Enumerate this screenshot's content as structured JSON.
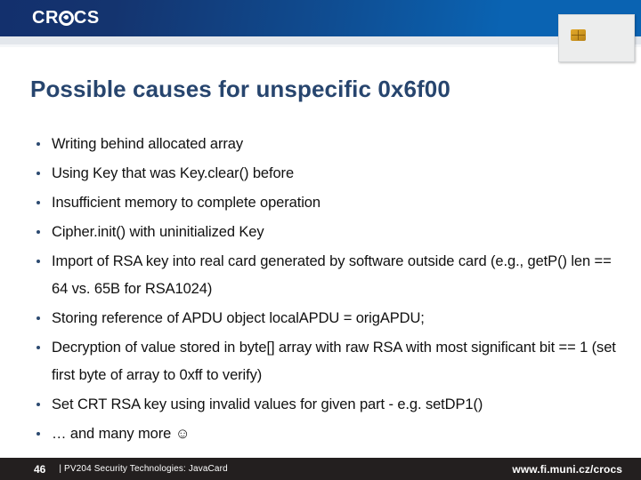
{
  "header": {
    "logo_text_left": "CR",
    "logo_text_right": "CS",
    "logo_mark_name": "crocs-circle-logo",
    "card_image_alt": "smart-card",
    "gradient_start": "#13306d",
    "gradient_end": "#0a63b2"
  },
  "slide": {
    "title": "Possible causes for unspecific 0x6f00",
    "title_color": "#27456e",
    "bullet_color": "#2c4a70",
    "bullets": [
      {
        "marker": "•",
        "text": "Writing behind allocated array"
      },
      {
        "marker": "•",
        "text": "Using Key that was Key.clear() before"
      },
      {
        "marker": "•",
        "text": "Insufficient memory to complete operation"
      },
      {
        "marker": "•",
        "text": "Cipher.init() with uninitialized Key"
      },
      {
        "marker": "•",
        "text": "Import of RSA key into real card generated by software outside card (e.g., getP() len == 64 vs. 65B for RSA1024)"
      },
      {
        "marker": "•",
        "text": "Storing reference of APDU object localAPDU = origAPDU;"
      },
      {
        "marker": "•",
        "text": "Decryption of value stored in byte[] array with raw RSA with most significant bit == 1 (set first byte of array to 0xff to verify)"
      },
      {
        "marker": "•",
        "text": "Set CRT RSA key using invalid values for given part - e.g. setDP1()"
      },
      {
        "marker": "•",
        "text": "… and many more ☺"
      }
    ]
  },
  "footer": {
    "page_number": "46",
    "label": "| PV204 Security Technologies: JavaCard",
    "url": "www.fi.muni.cz/crocs",
    "background": "#231f1f"
  }
}
